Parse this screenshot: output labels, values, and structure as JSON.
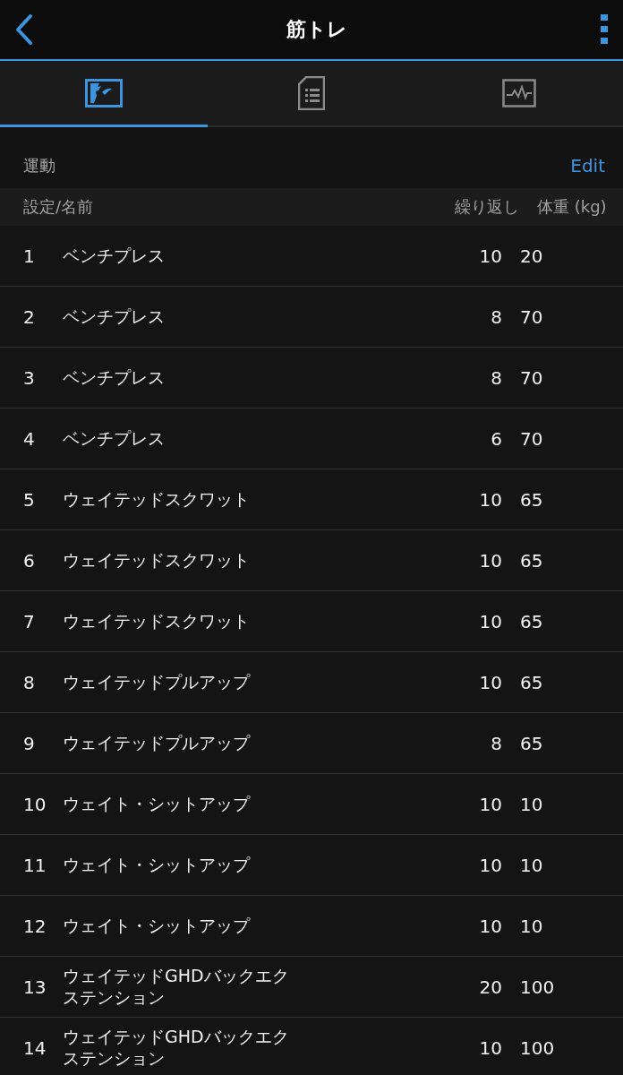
{
  "header": {
    "title": "筋トレ"
  },
  "tabs": [
    {
      "kind": "map",
      "selected": true
    },
    {
      "kind": "document",
      "selected": false
    },
    {
      "kind": "pulse",
      "selected": false
    }
  ],
  "section": {
    "title": "運動",
    "action": "Edit"
  },
  "table": {
    "columns": [
      "設定/名前",
      "繰り返し",
      "体重 (kg)"
    ],
    "rows": [
      {
        "set": "1",
        "name": "ベンチプレス",
        "reps": "10",
        "weight": "20"
      },
      {
        "set": "2",
        "name": "ベンチプレス",
        "reps": "8",
        "weight": "70"
      },
      {
        "set": "3",
        "name": "ベンチプレス",
        "reps": "8",
        "weight": "70"
      },
      {
        "set": "4",
        "name": "ベンチプレス",
        "reps": "6",
        "weight": "70"
      },
      {
        "set": "5",
        "name": "ウェイテッドスクワット",
        "reps": "10",
        "weight": "65"
      },
      {
        "set": "6",
        "name": "ウェイテッドスクワット",
        "reps": "10",
        "weight": "65"
      },
      {
        "set": "7",
        "name": "ウェイテッドスクワット",
        "reps": "10",
        "weight": "65"
      },
      {
        "set": "8",
        "name": "ウェイテッドプルアップ",
        "reps": "10",
        "weight": "65"
      },
      {
        "set": "9",
        "name": "ウェイテッドプルアップ",
        "reps": "8",
        "weight": "65"
      },
      {
        "set": "10",
        "name": "ウェイト・シットアップ",
        "reps": "10",
        "weight": "10"
      },
      {
        "set": "11",
        "name": "ウェイト・シットアップ",
        "reps": "10",
        "weight": "10"
      },
      {
        "set": "12",
        "name": "ウェイト・シットアップ",
        "reps": "10",
        "weight": "10"
      },
      {
        "set": "13",
        "name": "ウェイテッドGHDバックエクステンション",
        "reps": "20",
        "weight": "100"
      },
      {
        "set": "14",
        "name": "ウェイテッドGHDバックエクステンション",
        "reps": "10",
        "weight": "100"
      }
    ]
  }
}
